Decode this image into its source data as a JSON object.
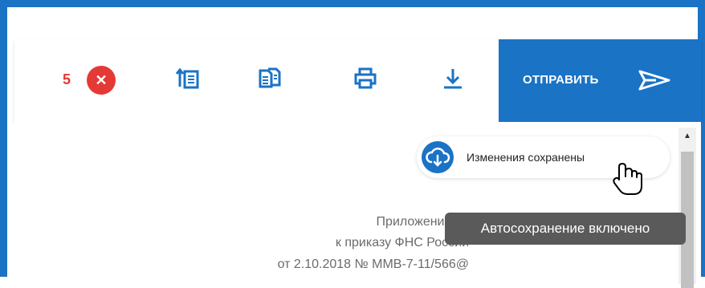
{
  "toolbar": {
    "error_count": "5",
    "error_badge_icon": "close-icon",
    "icons": [
      "list-sort-icon",
      "copy-document-icon",
      "print-icon",
      "download-icon"
    ],
    "send_label": "ОТПРАВИТЬ",
    "send_icon": "send-icon"
  },
  "status": {
    "saved_text": "Изменения сохранены",
    "tooltip": "Автосохранение включено"
  },
  "document": {
    "line1": "Приложение №",
    "line2": "к приказу ФНС России",
    "line3": "от 2.10.2018 № ММВ-7-11/566@"
  },
  "colors": {
    "accent": "#1a73c5",
    "error": "#e53935",
    "tooltip_bg": "#5a5a5a"
  }
}
